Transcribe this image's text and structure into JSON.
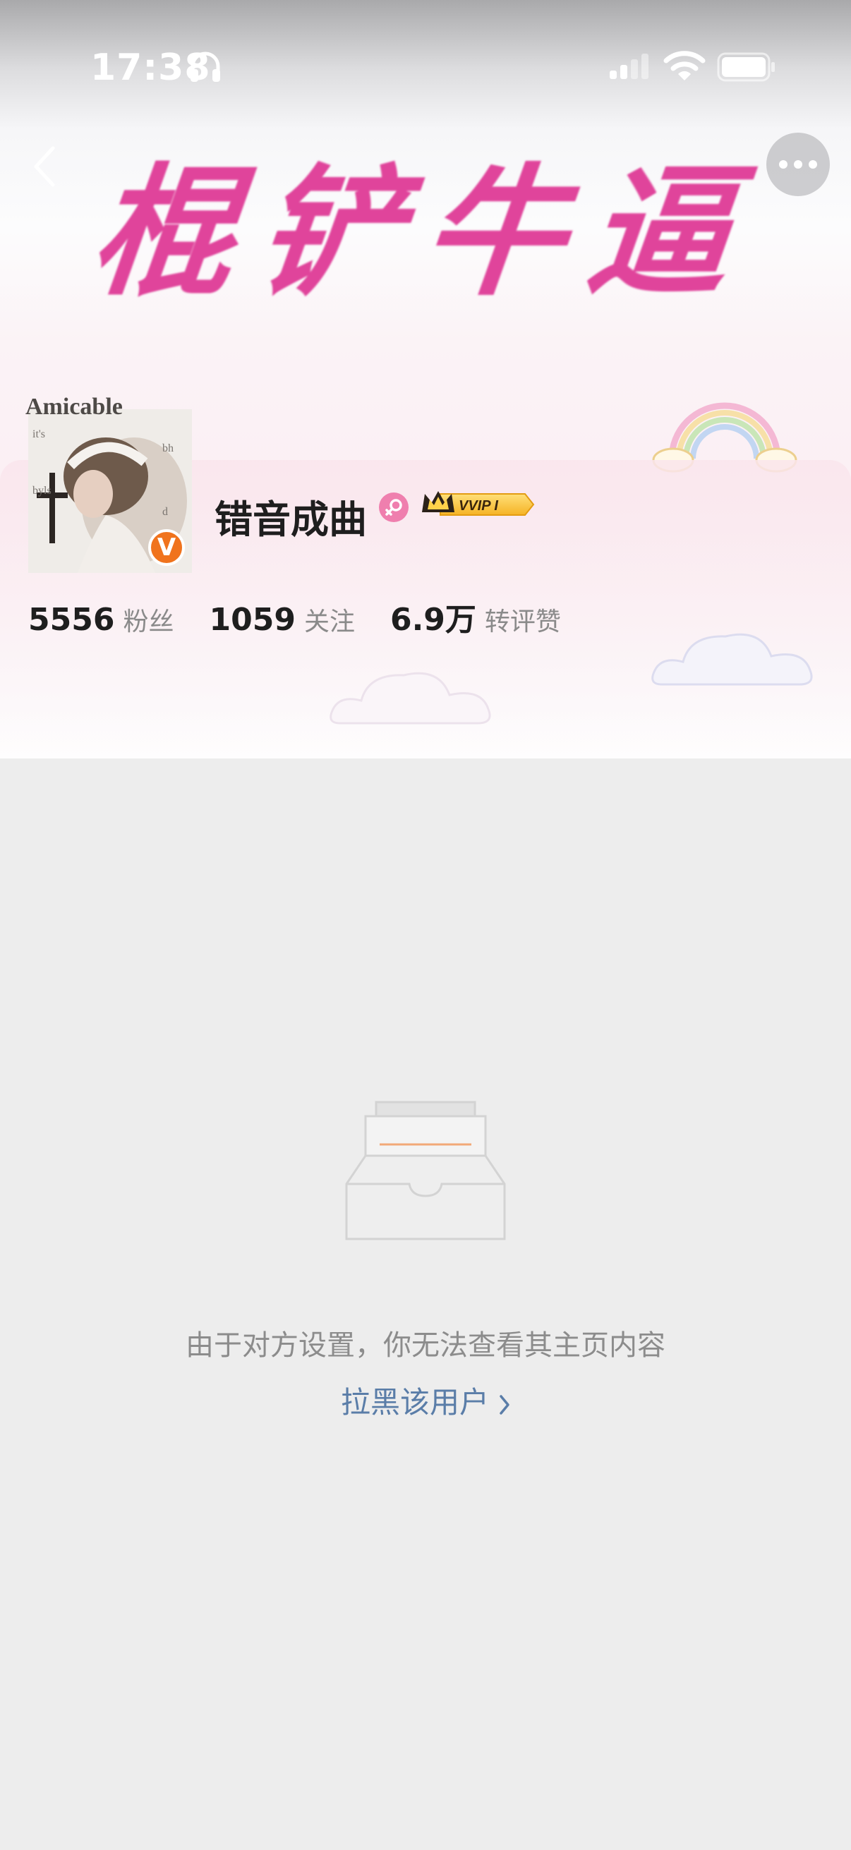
{
  "status_bar": {
    "time": "17:38",
    "icons": [
      "headphone-icon",
      "signal-icon",
      "wifi-icon",
      "battery-icon"
    ]
  },
  "nav": {
    "back_icon": "chevron-left-icon",
    "more_icon": "more-horizontal-icon"
  },
  "banner": {
    "text": "棍铲牛逼",
    "color": "#e0449b"
  },
  "profile": {
    "avatar_caption": "Amicable",
    "verified_icon": "V",
    "username": "错音成曲",
    "gender_icon": "female-icon",
    "vip_label": "VVIP I",
    "stats": [
      {
        "value": "5556",
        "label": "粉丝"
      },
      {
        "value": "1059",
        "label": "关注"
      },
      {
        "value": "6.9万",
        "label": "转评赞"
      }
    ]
  },
  "empty_state": {
    "icon": "empty-inbox-icon",
    "message": "由于对方设置，你无法查看其主页内容",
    "action_label": "拉黑该用户",
    "action_color": "#5a7da8"
  },
  "colors": {
    "page_background": "#ededed",
    "verified_badge": "#f0731d"
  }
}
